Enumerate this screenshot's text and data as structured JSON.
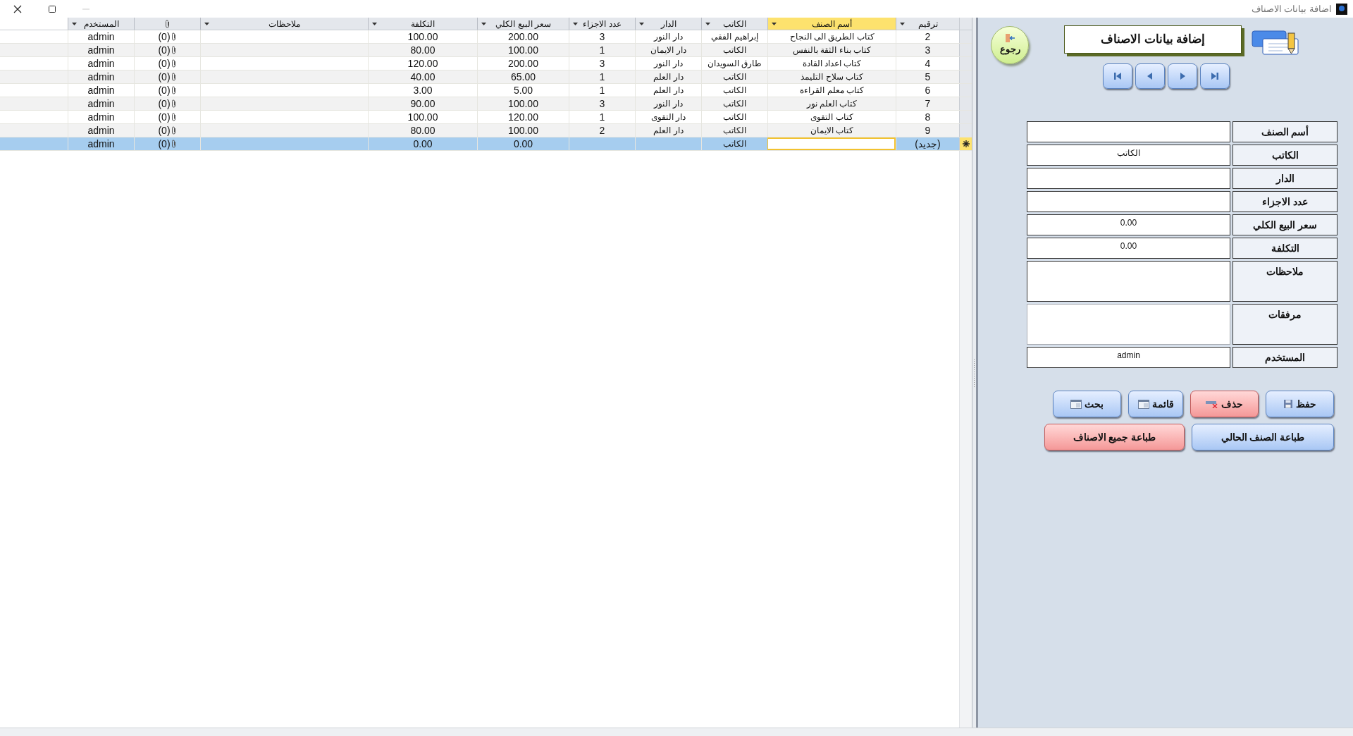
{
  "window": {
    "title": "اضافة بيانات الاصناف"
  },
  "table": {
    "columns": [
      {
        "label": "ترقيم",
        "kind": "text",
        "selected": false
      },
      {
        "label": "أسم الصنف",
        "kind": "text",
        "selected": true
      },
      {
        "label": "الكاتب",
        "kind": "text",
        "selected": false
      },
      {
        "label": "الدار",
        "kind": "text",
        "selected": false
      },
      {
        "label": "عدد الاجزاء",
        "kind": "text",
        "selected": false
      },
      {
        "label": "سعر البيع الكلي",
        "kind": "text",
        "selected": false
      },
      {
        "label": "التكلفة",
        "kind": "text",
        "selected": false
      },
      {
        "label": "ملاحظات",
        "kind": "text",
        "selected": false
      },
      {
        "kind": "attachment",
        "selected": false
      },
      {
        "label": "المستخدم",
        "kind": "text",
        "selected": false
      }
    ],
    "rows": [
      {
        "selected": false,
        "new": false,
        "cells": [
          "2",
          "كتاب الطريق الى النجاح",
          "إبراهيم الفقي",
          "دار النور",
          "3",
          "200.00",
          "100.00",
          null,
          "(0)",
          "admin"
        ]
      },
      {
        "selected": false,
        "new": false,
        "cells": [
          "3",
          "كتاب بناء الثقة بالنفس",
          "الكاتب",
          "دار الايمان",
          "1",
          "100.00",
          "80.00",
          null,
          "(0)",
          "admin"
        ]
      },
      {
        "selected": false,
        "new": false,
        "cells": [
          "4",
          "كتاب اعداد القادة",
          "طارق السويدان",
          "دار النور",
          "3",
          "200.00",
          "120.00",
          null,
          "(0)",
          "admin"
        ]
      },
      {
        "selected": false,
        "new": false,
        "cells": [
          "5",
          "كتاب سلاح التليمذ",
          "الكاتب",
          "دار العلم",
          "1",
          "65.00",
          "40.00",
          null,
          "(0)",
          "admin"
        ]
      },
      {
        "selected": false,
        "new": false,
        "cells": [
          "6",
          "كتاب معلم القراءة",
          "الكاتب",
          "دار العلم",
          "1",
          "5.00",
          "3.00",
          null,
          "(0)",
          "admin"
        ]
      },
      {
        "selected": false,
        "new": false,
        "cells": [
          "7",
          "كتاب العلم نور",
          "الكاتب",
          "دار النور",
          "3",
          "100.00",
          "90.00",
          null,
          "(0)",
          "admin"
        ]
      },
      {
        "selected": false,
        "new": false,
        "cells": [
          "8",
          "كتاب التقوى",
          "الكاتب",
          "دار التقوى",
          "1",
          "120.00",
          "100.00",
          null,
          "(0)",
          "admin"
        ]
      },
      {
        "selected": false,
        "new": false,
        "cells": [
          "9",
          "كتاب الايمان",
          "الكاتب",
          "دار العلم",
          "2",
          "100.00",
          "80.00",
          null,
          "(0)",
          "admin"
        ]
      },
      {
        "selected": true,
        "new": true,
        "cells": [
          "(جديد)",
          null,
          "الكاتب",
          null,
          null,
          "0.00",
          "0.00",
          null,
          "(0)",
          "admin"
        ]
      }
    ]
  },
  "panel": {
    "back_button": "رجوع",
    "title": "إضافة بيانات الاصناف",
    "fields": [
      {
        "label": "أسم الصنف",
        "kind": "text"
      },
      {
        "label": "الكاتب",
        "kind": "text",
        "value": "الكاتب"
      },
      {
        "label": "الدار",
        "kind": "text"
      },
      {
        "label": "عدد الاجزاء",
        "kind": "text"
      },
      {
        "label": "سعر البيع الكلي",
        "kind": "text",
        "value": "0.00"
      },
      {
        "label": "التكلفة",
        "kind": "text",
        "value": "0.00"
      },
      {
        "label": "ملاحظات",
        "kind": "memo"
      },
      {
        "label": "مرفقات",
        "kind": "attachment"
      },
      {
        "label": "المستخدم",
        "kind": "text",
        "value": "admin"
      }
    ],
    "buttons": [
      {
        "label": "حفظ",
        "kind": "normal"
      },
      {
        "label": "حذف",
        "kind": "danger"
      },
      {
        "label": "قائمة",
        "kind": "normal"
      },
      {
        "label": "بحث",
        "kind": "normal"
      }
    ],
    "print_buttons": [
      {
        "label": "طباعة الصنف الحالي",
        "kind": "normal"
      },
      {
        "label": "طباعة جميع الاصناف",
        "kind": "danger"
      }
    ]
  }
}
